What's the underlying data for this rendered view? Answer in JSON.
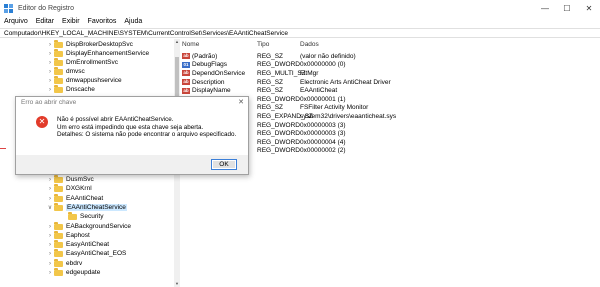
{
  "window": {
    "title": "Editor do Registro"
  },
  "menu": [
    "Arquivo",
    "Editar",
    "Exibir",
    "Favoritos",
    "Ajuda"
  ],
  "address": "Computador\\HKEY_LOCAL_MACHINE\\SYSTEM\\CurrentControlSet\\Services\\EAAntiCheatService",
  "tree": {
    "items": [
      {
        "label": "DispBrokerDesktopSvc",
        "expand": true
      },
      {
        "label": "DisplayEnhancementService",
        "expand": true
      },
      {
        "label": "DmEnrollmentSvc",
        "expand": true
      },
      {
        "label": "dmvsc",
        "expand": true
      },
      {
        "label": "dmwappushservice",
        "expand": true
      },
      {
        "label": "Dnscache",
        "expand": true
      },
      {
        "label": "DusmSvc",
        "expand": true
      },
      {
        "label": "DXGKrnl",
        "expand": true
      },
      {
        "label": "EAAntiCheat",
        "expand": true
      },
      {
        "label": "EAAntiCheatService",
        "expand": true,
        "expanded": true,
        "selected": true
      },
      {
        "label": "Security",
        "expand": false,
        "child": true
      },
      {
        "label": "EABackgroundService",
        "expand": true
      },
      {
        "label": "Eaphost",
        "expand": true
      },
      {
        "label": "EasyAntiCheat",
        "expand": true
      },
      {
        "label": "EasyAntiCheat_EOS",
        "expand": true
      },
      {
        "label": "ebdrv",
        "expand": true
      },
      {
        "label": "edgeupdate",
        "expand": true
      }
    ]
  },
  "list": {
    "headers": {
      "name": "Nome",
      "type": "Tipo",
      "data": "Dados"
    },
    "rows": [
      {
        "icon": "sz",
        "name": "(Padrão)",
        "type": "REG_SZ",
        "data": "(valor não definido)"
      },
      {
        "icon": "bin",
        "name": "DebugFlags",
        "type": "REG_DWORD",
        "data": "0x00000000 (0)"
      },
      {
        "icon": "sz",
        "name": "DependOnService",
        "type": "REG_MULTI_SZ",
        "data": "FltMgr"
      },
      {
        "icon": "sz",
        "name": "Description",
        "type": "REG_SZ",
        "data": "Electronic Arts AntiCheat Driver"
      },
      {
        "icon": "sz",
        "name": "DisplayName",
        "type": "REG_SZ",
        "data": "EAAntiCheat"
      },
      {
        "icon": "bin",
        "name": "",
        "type": "REG_DWORD",
        "data": "0x00000001 (1)"
      },
      {
        "icon": "sz",
        "name": "",
        "type": "REG_SZ",
        "data": "FSFilter Activity Monitor"
      },
      {
        "icon": "sz",
        "name": "",
        "type": "REG_EXPAND_SZ",
        "data": "system32\\drivers\\eaanticheat.sys"
      },
      {
        "icon": "bin",
        "name": "",
        "type": "REG_DWORD",
        "data": "0x00000003 (3)"
      },
      {
        "icon": "bin",
        "name": "",
        "type": "REG_DWORD",
        "data": "0x00000003 (3)"
      },
      {
        "icon": "bin",
        "name": "",
        "type": "REG_DWORD",
        "data": "0x00000004 (4)"
      },
      {
        "icon": "bin",
        "name": "",
        "type": "REG_DWORD",
        "data": "0x00000002 (2)"
      }
    ]
  },
  "dialog": {
    "title": "Erro ao abrir chave",
    "line1": "Não é possível abrir EAAntiCheatService.",
    "line2": "Um erro está impedindo que esta chave seja aberta.",
    "line3": "Detalhes: O sistema não pode encontrar o arquivo especificado.",
    "ok_label": "OK"
  }
}
